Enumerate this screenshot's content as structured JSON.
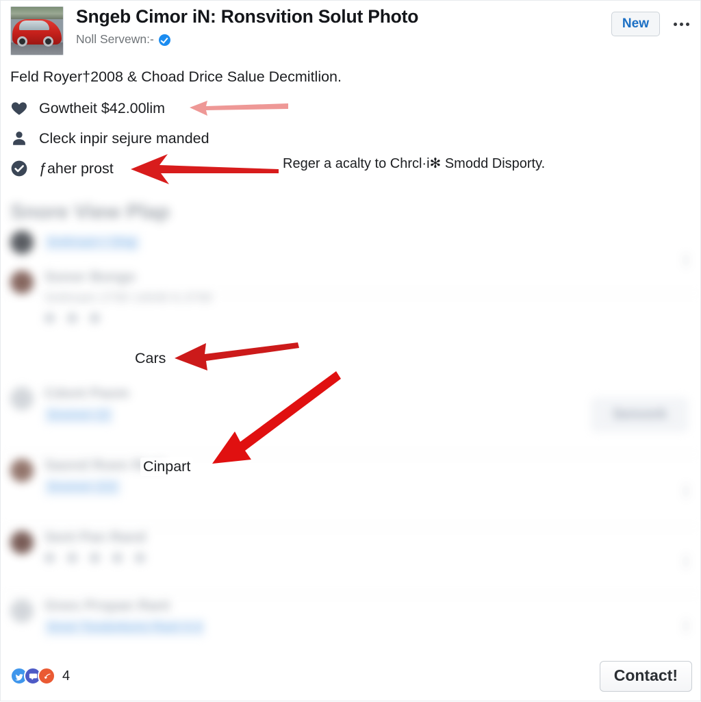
{
  "header": {
    "thumbnail_alt": "red-car-photo",
    "title": "Sngeb Cimor iN: Ronsvition Solut Photo",
    "subtitle": "Noll Servewn:-",
    "verified_icon": "verified-badge-icon",
    "new_button_label": "New",
    "more_icon": "ellipsis-icon"
  },
  "description": "Feld Royer†2008 & Choad Drice Salue Decmitlion.",
  "features": [
    {
      "icon": "heart-icon",
      "label": "Gowtheit $42.00lim"
    },
    {
      "icon": "person-icon",
      "label": "Cleck inpir sejure manded"
    },
    {
      "icon": "check-badge-icon",
      "label": "ƒaher prost"
    }
  ],
  "side_note": "Reger a acalty to Chrcl·i✻ Smodd Disporty.",
  "annotations": [
    {
      "label": "Cars",
      "target": "feature-row-2"
    },
    {
      "label": "Cinpart",
      "target": "blurred-row-4"
    }
  ],
  "blurred_section": {
    "heading": "Snore View Plap",
    "rows": [
      {
        "title": "",
        "link": "Snthnam t Shtp",
        "sub": "",
        "avatar_color": "#4b4f55",
        "trailing": "dots"
      },
      {
        "title": "Sonor Bongo",
        "link": "",
        "sub": "Snthnam 2700 14040  6.3700",
        "avatar_color": "#7c5a52",
        "trailing": "none"
      },
      {
        "title": "Cdont Paom",
        "link": "Snonon 22",
        "sub": "",
        "avatar_color": "#cfd3d8",
        "trailing": "button",
        "button_label": "Senvork"
      },
      {
        "title": "Saond Roen Rant",
        "link": "Snonon 222",
        "sub": "",
        "avatar_color": "#8a6a60",
        "trailing": "dots"
      },
      {
        "title": "Sent Pan Rand",
        "link": "",
        "sub": "",
        "avatar_color": "#6e4f49",
        "trailing": "dots"
      },
      {
        "title": "Gnes Propan Rant",
        "link": "Snon Toodorbons Rant 4.4",
        "sub": "",
        "avatar_color": "#cfd3d8",
        "trailing": "dots"
      }
    ]
  },
  "footer": {
    "reactions": [
      {
        "icon": "like-reaction-icon",
        "color": "#3f96ec"
      },
      {
        "icon": "care-reaction-icon",
        "color": "#4d5ac6"
      },
      {
        "icon": "haha-reaction-icon",
        "color": "#ea5a33"
      }
    ],
    "reaction_count": "4",
    "contact_button_label": "Contact!"
  },
  "colors": {
    "accent_blue": "#1b6fc4",
    "verified_blue": "#1b8cf0",
    "arrow_red": "#d81c1c",
    "arrow_red_soft": "#e8716e",
    "text_primary": "#1c1e21",
    "text_muted": "#6f7478"
  }
}
